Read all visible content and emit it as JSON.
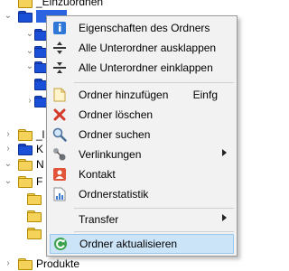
{
  "tree": {
    "top_label": "_Einzuordnen",
    "partial_labels": [
      "_l",
      "K",
      "N",
      "F"
    ],
    "bottom_label": "Produkte"
  },
  "menu": {
    "items": [
      {
        "label": "Eigenschaften des Ordners",
        "icon": "info-icon"
      },
      {
        "label": "Alle Unterordner ausklappen",
        "icon": "expand-all-icon"
      },
      {
        "label": "Alle Unterordner einklappen",
        "icon": "collapse-all-icon"
      },
      {
        "label": "Ordner hinzufügen",
        "shortcut": "Einfg",
        "icon": "add-folder-icon"
      },
      {
        "label": "Ordner löschen",
        "icon": "delete-icon"
      },
      {
        "label": "Ordner suchen",
        "icon": "search-icon"
      },
      {
        "label": "Verlinkungen",
        "icon": "link-icon",
        "submenu": true
      },
      {
        "label": "Kontakt",
        "icon": "contact-icon"
      },
      {
        "label": "Ordnerstatistik",
        "icon": "statistics-icon"
      },
      {
        "label": "Transfer",
        "submenu": true
      },
      {
        "label": "Ordner aktualisieren",
        "icon": "refresh-icon",
        "highlighted": true
      }
    ]
  },
  "colors": {
    "menu_background": "#f2f2f2",
    "highlight": "#cce4f7",
    "folder_blue": "#1a4fd8",
    "folder_yellow": "#f5d35a"
  }
}
